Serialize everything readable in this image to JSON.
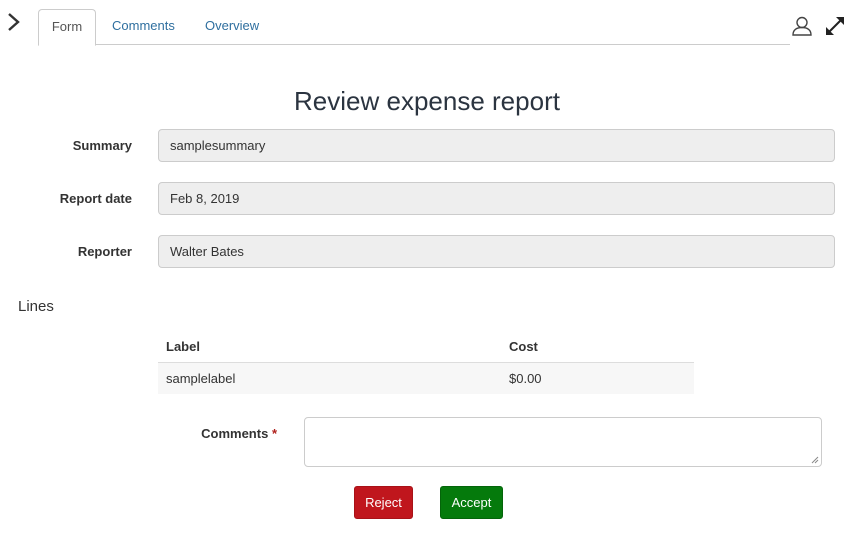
{
  "nav": {
    "tabs": [
      {
        "label": "Form",
        "active": true
      },
      {
        "label": "Comments",
        "active": false
      },
      {
        "label": "Overview",
        "active": false
      }
    ],
    "icons": [
      "chevron-right-icon",
      "user-icon",
      "expand-icon"
    ]
  },
  "form": {
    "title": "Review expense report",
    "fields": [
      {
        "label": "Summary",
        "value": "samplesummary"
      },
      {
        "label": "Report date",
        "value": "Feb 8, 2019"
      },
      {
        "label": "Reporter",
        "value": "Walter Bates"
      }
    ],
    "lines": {
      "label": "Lines",
      "columns": [
        "Label",
        "Cost"
      ],
      "rows": [
        [
          "samplelabel",
          "$0.00"
        ]
      ]
    },
    "comments": {
      "label": "Comments",
      "required_marker": "*",
      "value": ""
    },
    "buttons": {
      "reject": "Reject",
      "accept": "Accept"
    }
  },
  "colors": {
    "link": "#2f6f9f",
    "reject": "#c0161d",
    "accept": "#057a0c",
    "required": "#b0201c",
    "readonly_field_bg": "#eeeeee"
  }
}
